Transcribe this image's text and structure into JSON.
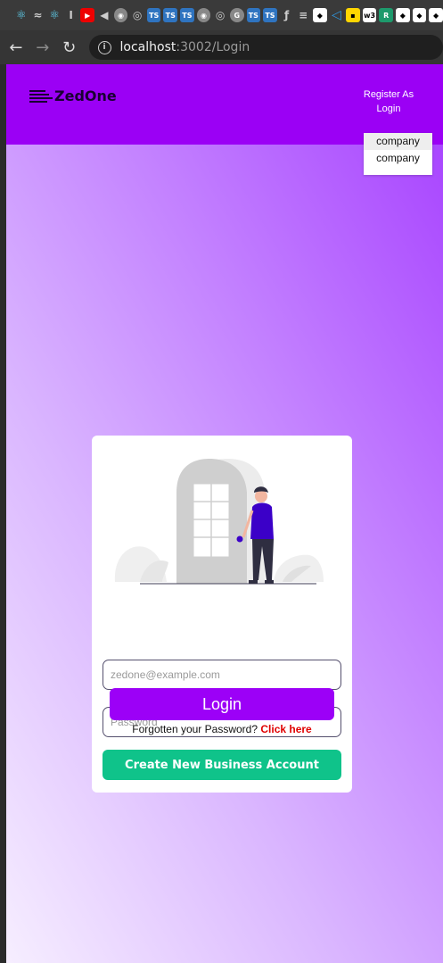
{
  "bookmarks": [
    {
      "icon": "react-icon",
      "glyph": "⚛"
    },
    {
      "icon": "tailwind-icon",
      "glyph": "≈"
    },
    {
      "icon": "react-icon",
      "glyph": "⚛"
    },
    {
      "icon": "bookmark-icon",
      "glyph": "I"
    },
    {
      "icon": "youtube-icon",
      "glyph": "▶"
    },
    {
      "icon": "speaker-icon",
      "glyph": "◀"
    },
    {
      "icon": "globe-icon",
      "glyph": "◉"
    },
    {
      "icon": "github-icon",
      "glyph": "◎"
    },
    {
      "icon": "typescript-icon",
      "glyph": "TS"
    },
    {
      "icon": "typescript-icon",
      "glyph": "TS"
    },
    {
      "icon": "typescript-icon",
      "glyph": "TS"
    },
    {
      "icon": "globe-icon",
      "glyph": "◉"
    },
    {
      "icon": "github-icon",
      "glyph": "◎"
    },
    {
      "icon": "google-icon",
      "glyph": "G"
    },
    {
      "icon": "typescript-icon",
      "glyph": "TS"
    },
    {
      "icon": "typescript-icon",
      "glyph": "TS"
    },
    {
      "icon": "flutter-icon",
      "glyph": "ƒ"
    },
    {
      "icon": "stackoverflow-icon",
      "glyph": "≡"
    },
    {
      "icon": "extension-icon",
      "glyph": "◆"
    },
    {
      "icon": "vscode-icon",
      "glyph": "◁"
    },
    {
      "icon": "yellow-extension-icon",
      "glyph": "▪"
    },
    {
      "icon": "w3schools-icon",
      "glyph": "w3"
    },
    {
      "icon": "r-icon",
      "glyph": "R"
    },
    {
      "icon": "extension-icon",
      "glyph": "◆"
    },
    {
      "icon": "extension-icon",
      "glyph": "◆"
    },
    {
      "icon": "extension-icon",
      "glyph": "◆"
    }
  ],
  "browser": {
    "url_host": "localhost",
    "url_rest": ":3002/Login"
  },
  "header": {
    "logo_text": "ZedOne",
    "register_label": "Register As Login",
    "dropdown_options": [
      "company",
      "company"
    ]
  },
  "login": {
    "email_placeholder": "zedone@example.com",
    "password_placeholder": "Password",
    "login_button": "Login",
    "forgot_text": "Forgotten your Password?",
    "forgot_link": "Click here",
    "create_button": "Create New Business Account"
  },
  "colors": {
    "header": "#9b00f5",
    "login_button": "#9c00f7",
    "create_button": "#0fc38a",
    "link": "#e00000"
  }
}
